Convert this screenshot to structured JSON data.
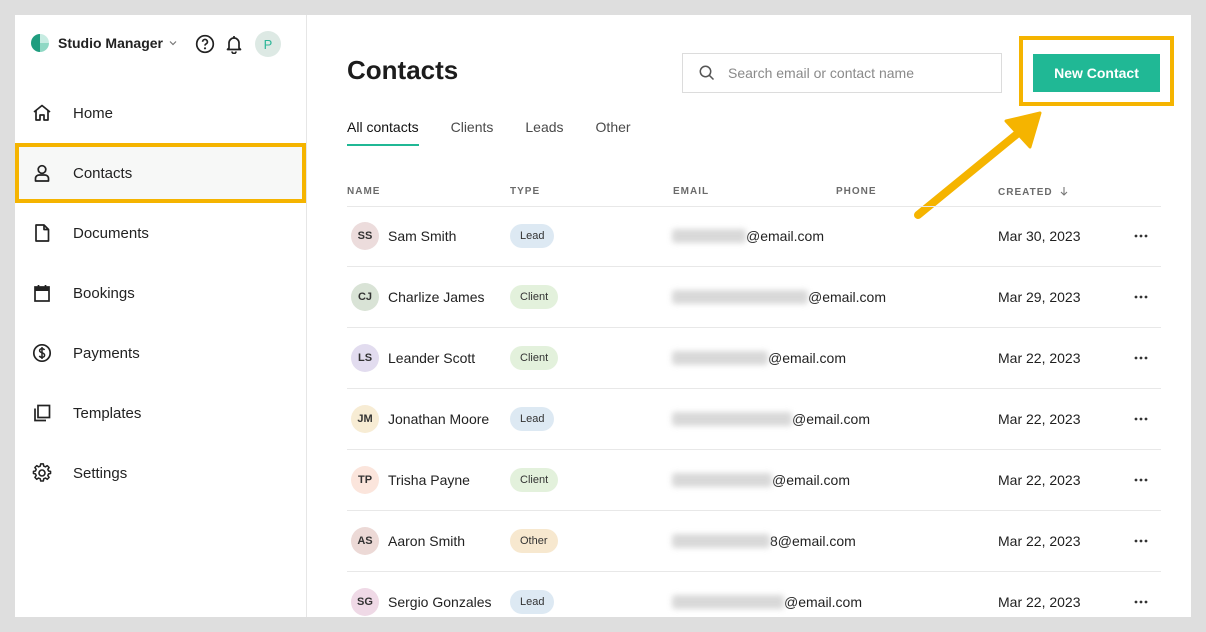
{
  "app": {
    "name": "Studio Manager",
    "avatar_initial": "P"
  },
  "nav": [
    {
      "key": "home",
      "label": "Home",
      "icon": "home-icon",
      "active": false
    },
    {
      "key": "contacts",
      "label": "Contacts",
      "icon": "user-icon",
      "active": true
    },
    {
      "key": "documents",
      "label": "Documents",
      "icon": "document-icon",
      "active": false
    },
    {
      "key": "bookings",
      "label": "Bookings",
      "icon": "calendar-icon",
      "active": false
    },
    {
      "key": "payments",
      "label": "Payments",
      "icon": "dollar-icon",
      "active": false
    },
    {
      "key": "templates",
      "label": "Templates",
      "icon": "copy-icon",
      "active": false
    },
    {
      "key": "settings",
      "label": "Settings",
      "icon": "gear-icon",
      "active": false
    }
  ],
  "page": {
    "title": "Contacts"
  },
  "search": {
    "placeholder": "Search email or contact name",
    "value": ""
  },
  "new_contact": {
    "label": "New Contact"
  },
  "tabs": [
    {
      "label": "All contacts",
      "active": true
    },
    {
      "label": "Clients",
      "active": false
    },
    {
      "label": "Leads",
      "active": false
    },
    {
      "label": "Other",
      "active": false
    }
  ],
  "columns": {
    "name": "NAME",
    "type": "TYPE",
    "email": "EMAIL",
    "phone": "PHONE",
    "created": "CREATED"
  },
  "badge_colors": {
    "Lead": "#dde9f3",
    "Client": "#e3f1dc",
    "Other": "#f7e8cf"
  },
  "contacts": [
    {
      "initials": "SS",
      "avatar_color": "#ecdcdc",
      "name": "Sam Smith",
      "type": "Lead",
      "email_domain": "@email.com",
      "created": "Mar 30, 2023"
    },
    {
      "initials": "CJ",
      "avatar_color": "#d9e3d6",
      "name": "Charlize James",
      "type": "Client",
      "email_domain": "@email.com",
      "created": "Mar 29, 2023"
    },
    {
      "initials": "LS",
      "avatar_color": "#e2dcef",
      "name": "Leander Scott",
      "type": "Client",
      "email_domain": "@email.com",
      "created": "Mar 22, 2023"
    },
    {
      "initials": "JM",
      "avatar_color": "#f7ecd4",
      "name": "Jonathan Moore",
      "type": "Lead",
      "email_domain": "@email.com",
      "created": "Mar 22, 2023"
    },
    {
      "initials": "TP",
      "avatar_color": "#fbe5dc",
      "name": "Trisha Payne",
      "type": "Client",
      "email_domain": "@email.com",
      "created": "Mar 22, 2023"
    },
    {
      "initials": "AS",
      "avatar_color": "#ecd9d6",
      "name": "Aaron Smith",
      "type": "Other",
      "email_domain": "8@email.com",
      "created": "Mar 22, 2023"
    },
    {
      "initials": "SG",
      "avatar_color": "#efd9e6",
      "name": "Sergio Gonzales",
      "type": "Lead",
      "email_domain": "@email.com",
      "created": "Mar 22, 2023"
    }
  ],
  "colors": {
    "accent": "#20b895",
    "highlight": "#f5b400"
  }
}
